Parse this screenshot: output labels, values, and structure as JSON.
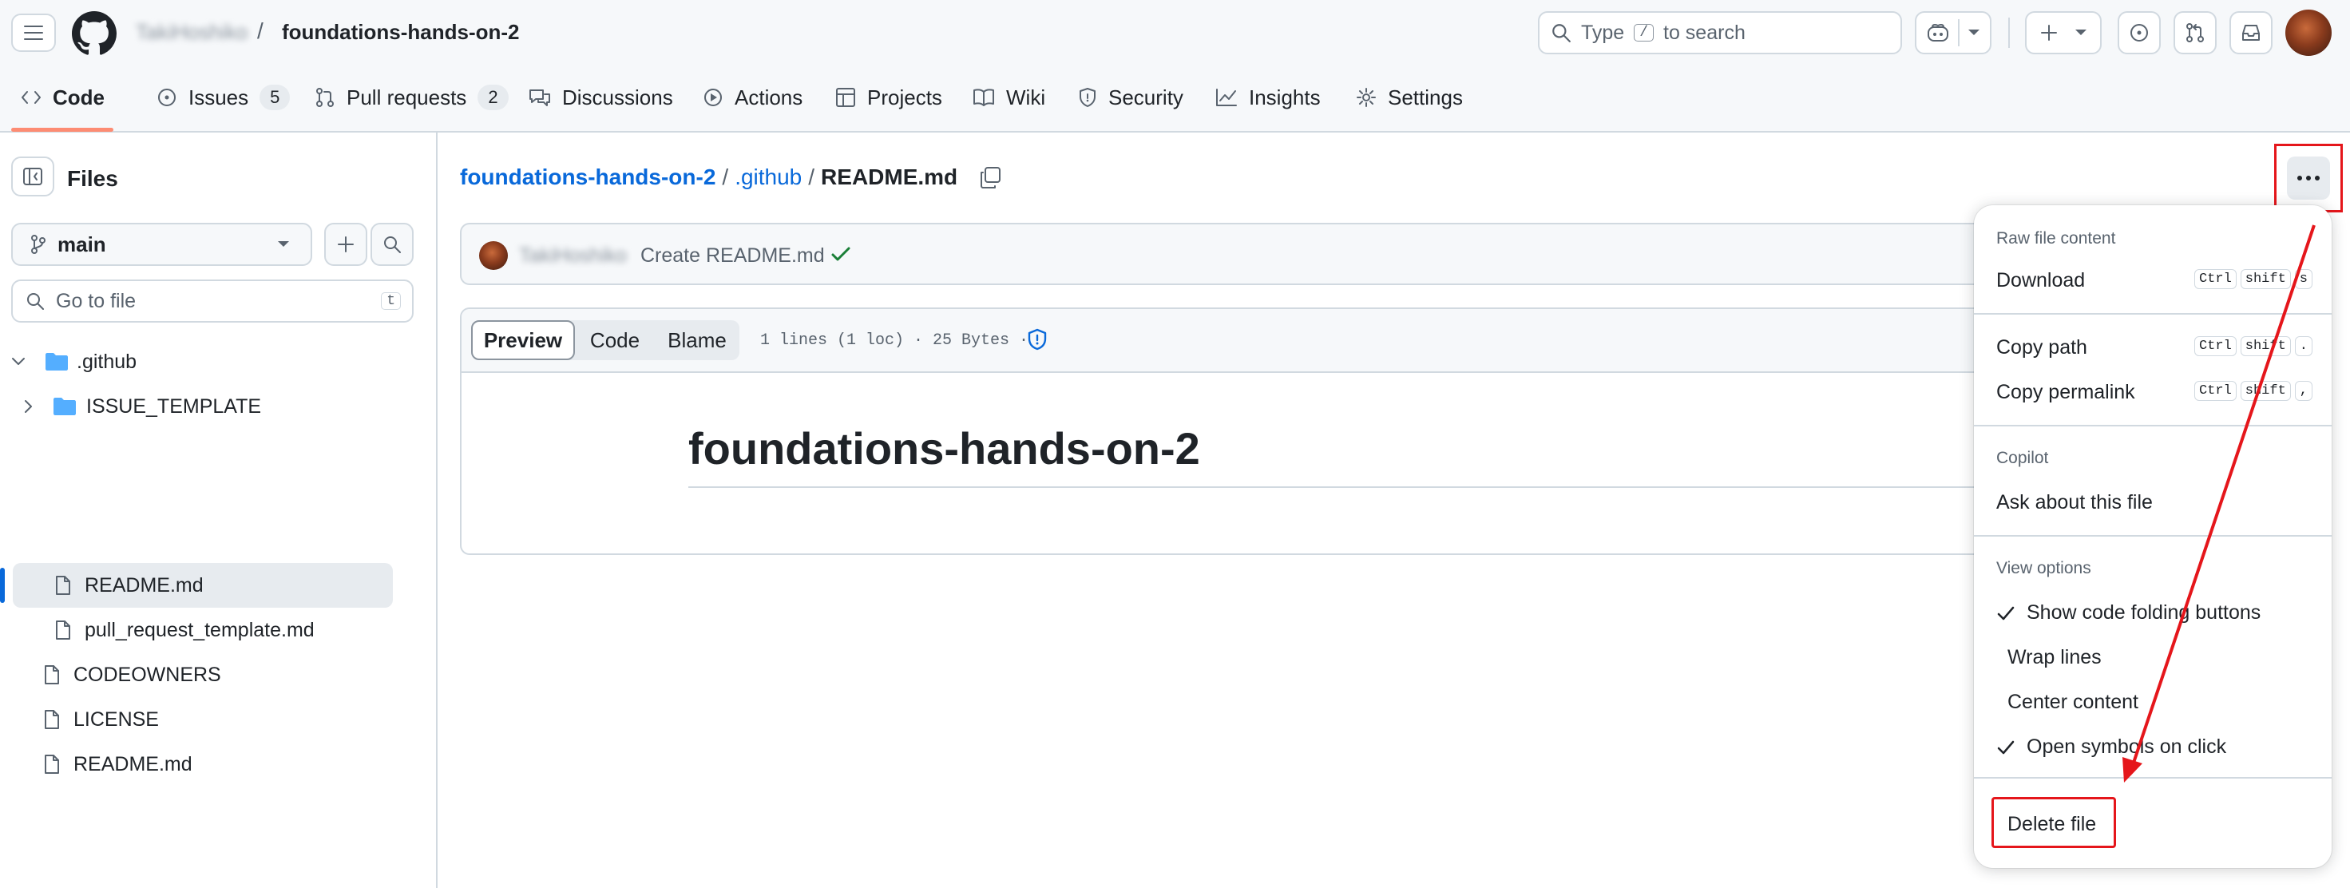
{
  "header": {
    "owner": "TakiHoshiko",
    "repo_sep": "/",
    "repo": "foundations-hands-on-2",
    "search_prefix": "Type",
    "search_key": "/",
    "search_suffix": "to search"
  },
  "tabs": [
    {
      "label": "Code",
      "icon": "code-icon"
    },
    {
      "label": "Issues",
      "icon": "issue-icon",
      "count": "5"
    },
    {
      "label": "Pull requests",
      "icon": "pull-request-icon",
      "count": "2"
    },
    {
      "label": "Discussions",
      "icon": "discussion-icon"
    },
    {
      "label": "Actions",
      "icon": "play-icon"
    },
    {
      "label": "Projects",
      "icon": "table-icon"
    },
    {
      "label": "Wiki",
      "icon": "book-icon"
    },
    {
      "label": "Security",
      "icon": "shield-icon"
    },
    {
      "label": "Insights",
      "icon": "graph-icon"
    },
    {
      "label": "Settings",
      "icon": "gear-icon"
    }
  ],
  "sidebar": {
    "title": "Files",
    "branch": "main",
    "filter_placeholder": "Go to file",
    "filter_key": "t",
    "tree": [
      {
        "label": ".github",
        "type": "folder",
        "expanded": true
      },
      {
        "label": "ISSUE_TEMPLATE",
        "type": "folder",
        "expanded": false
      },
      {
        "label": "README.md",
        "type": "file",
        "selected": true
      },
      {
        "label": "pull_request_template.md",
        "type": "file"
      },
      {
        "label": "CODEOWNERS",
        "type": "file"
      },
      {
        "label": "LICENSE",
        "type": "file"
      },
      {
        "label": "README.md",
        "type": "file"
      }
    ]
  },
  "breadcrumb": {
    "repo": "foundations-hands-on-2",
    "sep1": "/",
    "folder": ".github",
    "sep2": "/",
    "file": "README.md"
  },
  "commit": {
    "author": "TakiHoshiko",
    "message": "Create README.md"
  },
  "file_view": {
    "modes": [
      "Preview",
      "Code",
      "Blame"
    ],
    "active_mode": "Preview",
    "meta": "1 lines (1 loc) · 25 Bytes ·",
    "heading": "foundations-hands-on-2"
  },
  "menu": {
    "section_raw": "Raw file content",
    "download": "Download",
    "download_keys": [
      "Ctrl",
      "shift",
      "s"
    ],
    "copy_path": "Copy path",
    "copy_path_keys": [
      "Ctrl",
      "shift",
      "."
    ],
    "copy_permalink": "Copy permalink",
    "copy_permalink_keys": [
      "Ctrl",
      "shift",
      ","
    ],
    "section_copilot": "Copilot",
    "ask": "Ask about this file",
    "section_view": "View options",
    "opt_folding": "Show code folding buttons",
    "opt_wrap": "Wrap lines",
    "opt_center": "Center content",
    "opt_symbols": "Open symbols on click",
    "delete": "Delete file"
  },
  "colors": {
    "accent_link": "#0969da",
    "tab_underline": "#fd8c73",
    "annotation_red": "#e5161b",
    "success_green": "#1a7f37",
    "folder_blue": "#54aeff"
  }
}
